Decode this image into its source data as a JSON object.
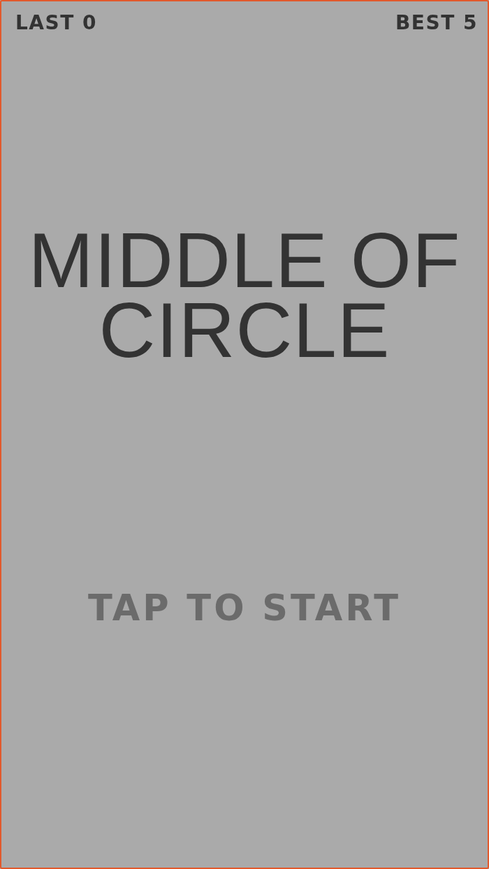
{
  "scores": {
    "last": "LAST 0",
    "best": "BEST 5"
  },
  "title": "MIDDLE OF CIRCLE",
  "prompt": "TAP TO START"
}
